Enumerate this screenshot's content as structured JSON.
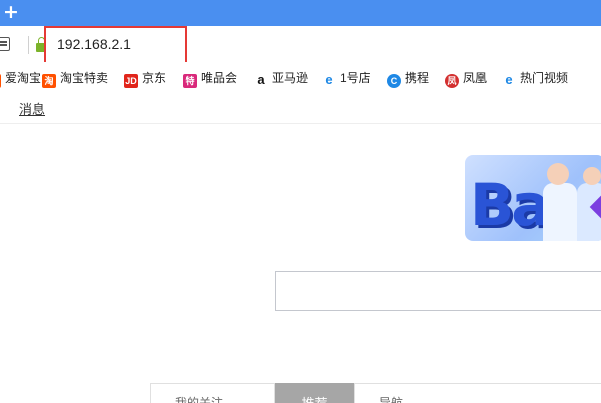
{
  "tabstrip": {
    "new_tab_symbol": "+"
  },
  "toolbar": {
    "url": "192.168.2.1"
  },
  "bookmarks": [
    {
      "label": "爱淘宝",
      "icon": "taobao-icon",
      "color": "#ff5000"
    },
    {
      "label": "淘宝特卖",
      "icon": "taobao-tao-icon",
      "color": "#ff5000"
    },
    {
      "label": "京东",
      "icon": "jd-icon",
      "color": "#e1251b"
    },
    {
      "label": "唯品会",
      "icon": "vip-icon",
      "color": "#d9297b"
    },
    {
      "label": "亚马逊",
      "icon": "amazon-icon",
      "color": "#111111"
    },
    {
      "label": "1号店",
      "icon": "ie-icon",
      "color": "#1e88e5"
    },
    {
      "label": "携程",
      "icon": "ctrip-icon",
      "color": "#1e88e5"
    },
    {
      "label": "凤凰",
      "icon": "ifeng-icon",
      "color": "#d32f2f"
    },
    {
      "label": "热门视频",
      "icon": "ie-icon",
      "color": "#1e88e5"
    }
  ],
  "subnav": {
    "message_link": "消息"
  },
  "search": {
    "placeholder": ""
  },
  "tabs": {
    "tab1": "我的关注",
    "tab2": "推荐",
    "tab3": "导航"
  }
}
